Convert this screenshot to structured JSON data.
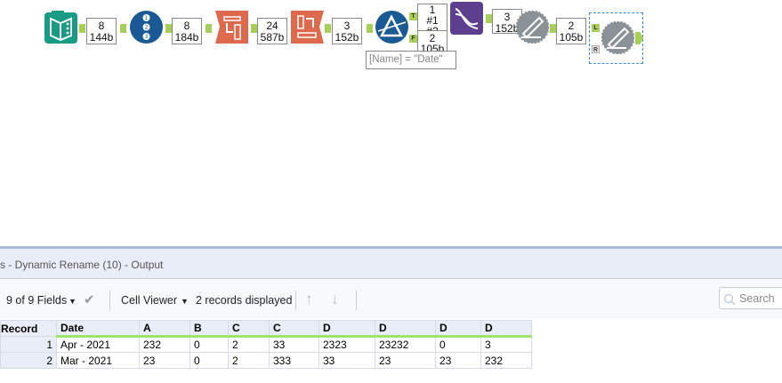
{
  "workflow": {
    "tools": [
      {
        "name": "input-data",
        "icon": "book-icon",
        "color": "#1a9b86"
      },
      {
        "name": "record-id",
        "icon": "numbered-list-icon",
        "color": "#1a5a94"
      },
      {
        "name": "transpose",
        "icon": "transpose-icon",
        "color": "#dd6a4c"
      },
      {
        "name": "cross-tab",
        "icon": "crosstab-icon",
        "color": "#dd6a4c"
      },
      {
        "name": "filter",
        "icon": "filter-prism-icon",
        "color": "#1a5a94"
      },
      {
        "name": "regex",
        "icon": "dna-icon",
        "color": "#5c3f8f"
      },
      {
        "name": "dynamic-rename",
        "icon": "dynamic-rename-icon",
        "color": "#8a9298"
      },
      {
        "name": "dynamic-rename-selected",
        "icon": "dynamic-rename-icon",
        "color": "#8a9298"
      }
    ],
    "connections": [
      {
        "records": "8",
        "size": "144b"
      },
      {
        "records": "8",
        "size": "184b"
      },
      {
        "records": "24",
        "size": "587b"
      },
      {
        "records": "3",
        "size": "152b"
      },
      {
        "records": "1",
        "size": "#1"
      },
      {
        "records": "#2",
        "size": ""
      },
      {
        "records": "2",
        "size": "105b"
      },
      {
        "records": "3",
        "size": "152b"
      },
      {
        "records": "2",
        "size": "105b"
      }
    ],
    "anchors": {
      "true": "T",
      "false": "F",
      "left": "L",
      "right": "R"
    },
    "filter_annotation": "[Name] = \"Date\""
  },
  "results": {
    "title": "s - Dynamic Rename (10) - Output",
    "fields_selector": "9 of 9 Fields",
    "cell_viewer": "Cell Viewer",
    "records_displayed": "2 records displayed",
    "search_placeholder": "Search",
    "columns": [
      "Record",
      "Date",
      "A",
      "B",
      "C",
      "C",
      "D",
      "D",
      "D",
      "D"
    ],
    "rows": [
      [
        "1",
        "Apr - 2021",
        "232",
        "0",
        "2",
        "33",
        "2323",
        "23232",
        "0",
        "3"
      ],
      [
        "2",
        "Mar - 2021",
        "23",
        "0",
        "2",
        "333",
        "33",
        "23",
        "23",
        "232"
      ]
    ]
  }
}
